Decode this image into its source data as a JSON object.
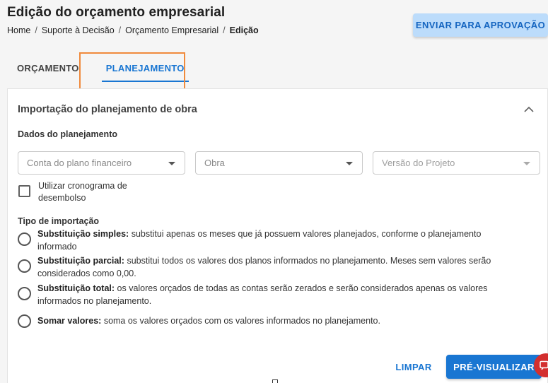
{
  "header": {
    "title": "Edição do orçamento empresarial",
    "breadcrumb": [
      "Home",
      "Suporte à Decisão",
      "Orçamento Empresarial",
      "Edição"
    ],
    "breadcrumb_separator": "/",
    "approve_button": "ENVIAR PARA APROVAÇÃO"
  },
  "tabs": [
    {
      "label": "ORÇAMENTO",
      "active": false
    },
    {
      "label": "PLANEJAMENTO",
      "active": true
    }
  ],
  "card": {
    "title": "Importação do planejamento de obra",
    "collapse_icon": "chevron-up-icon",
    "planning_section": {
      "label": "Dados do planejamento",
      "selects": [
        {
          "placeholder": "Conta do plano financeiro",
          "enabled": true
        },
        {
          "placeholder": "Obra",
          "enabled": true
        },
        {
          "placeholder": "Versão do Projeto",
          "enabled": false
        }
      ],
      "checkbox": {
        "label": "Utilizar cronograma de desembolso",
        "checked": false
      }
    },
    "import_type": {
      "label": "Tipo de importação",
      "options": [
        {
          "title": "Substituição simples:",
          "text": "substitui apenas os meses que já possuem valores planejados, conforme o planejamento informado"
        },
        {
          "title": "Substituição parcial:",
          "text": "substitui todos os valores dos planos informados no planejamento. Meses sem valores serão considerados como 0,00."
        },
        {
          "title": "Substituição total:",
          "text": "os valores orçados de todas as contas serão zerados e serão considerados apenas os valores informados no planejamento."
        },
        {
          "title": "Somar valores:",
          "text": "soma os valores orçados com os valores informados no planejamento."
        }
      ]
    },
    "actions": {
      "clear": "LIMPAR",
      "preview": "PRÉ-VISUALIZAR"
    }
  },
  "colors": {
    "primary": "#1976d2",
    "approve_bg": "#bcdcfb",
    "highlight": "#f08a3c",
    "fab": "#d32f2f"
  }
}
